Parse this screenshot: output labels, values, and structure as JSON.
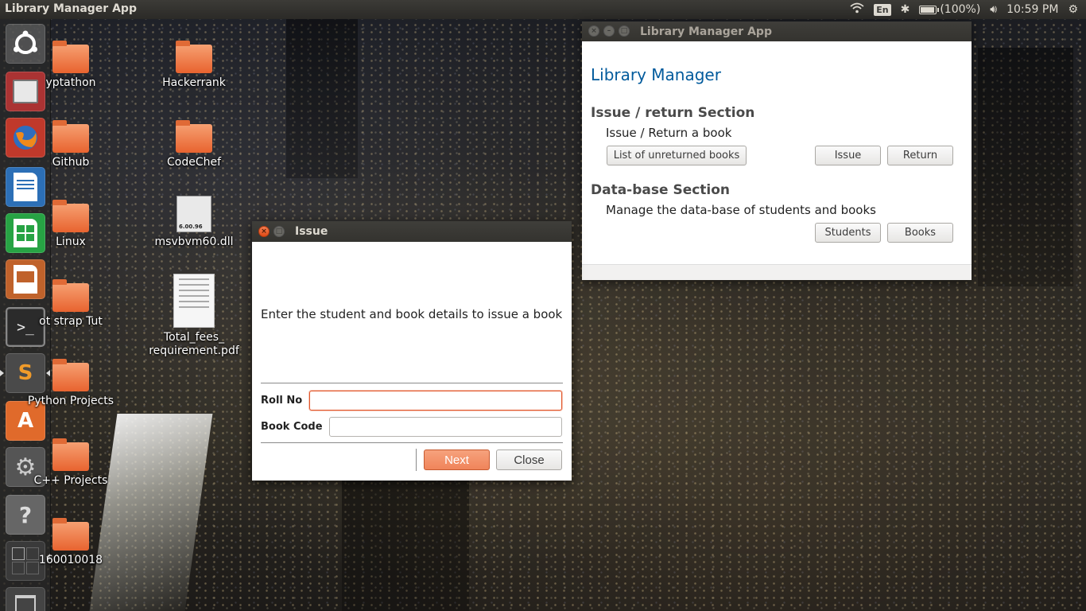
{
  "top_panel": {
    "app_title": "Library Manager App",
    "keyboard_layout": "En",
    "battery_text": "(100%)",
    "battery_level": 1.0,
    "time": "10:59 PM"
  },
  "launcher": {
    "items": [
      {
        "name": "ubuntu-dash",
        "icon": "ubuntu-logo-icon"
      },
      {
        "name": "files",
        "icon": "file-cabinet-icon"
      },
      {
        "name": "firefox",
        "icon": "firefox-icon"
      },
      {
        "name": "libreoffice-writer",
        "icon": "writer-icon"
      },
      {
        "name": "libreoffice-calc",
        "icon": "calc-icon"
      },
      {
        "name": "libreoffice-impress",
        "icon": "impress-icon"
      },
      {
        "name": "terminal",
        "icon": "terminal-icon"
      },
      {
        "name": "sublime-text",
        "icon": "sublime-icon"
      },
      {
        "name": "software-center",
        "icon": "software-center-icon"
      },
      {
        "name": "system-settings",
        "icon": "settings-icon"
      },
      {
        "name": "help",
        "icon": "help-icon"
      },
      {
        "name": "workspaces",
        "icon": "workspace-switcher-icon"
      },
      {
        "name": "trash",
        "icon": "trash-icon"
      }
    ]
  },
  "desktop": {
    "icons": [
      {
        "label": "yptathon"
      },
      {
        "label": "Hackerrank"
      },
      {
        "label": "Github"
      },
      {
        "label": "CodeChef"
      },
      {
        "label": "Linux"
      },
      {
        "label": "msvbvm60.dll"
      },
      {
        "label": "ot strap Tut"
      },
      {
        "label": "Total_fees_\nrequirement.pdf"
      },
      {
        "label": "Python Projects"
      },
      {
        "label": "C++ Projects"
      },
      {
        "label": "160010018"
      }
    ],
    "dll_badge": "6.00.96"
  },
  "main_window": {
    "title": "Library Manager App",
    "heading": "Library Manager",
    "issue_section": {
      "title": "Issue / return Section",
      "description": "Issue / Return a book",
      "list_button": "List of unreturned books",
      "issue_button": "Issue",
      "return_button": "Return"
    },
    "db_section": {
      "title": "Data-base Section",
      "description": "Manage the data-base of students and books",
      "students_button": "Students",
      "books_button": "Books"
    }
  },
  "issue_dialog": {
    "title": "Issue",
    "message": "Enter the student and book details to issue a book",
    "roll_label": "Roll No",
    "roll_value": "",
    "book_label": "Book Code",
    "book_value": "",
    "next_button": "Next",
    "close_button": "Close"
  }
}
